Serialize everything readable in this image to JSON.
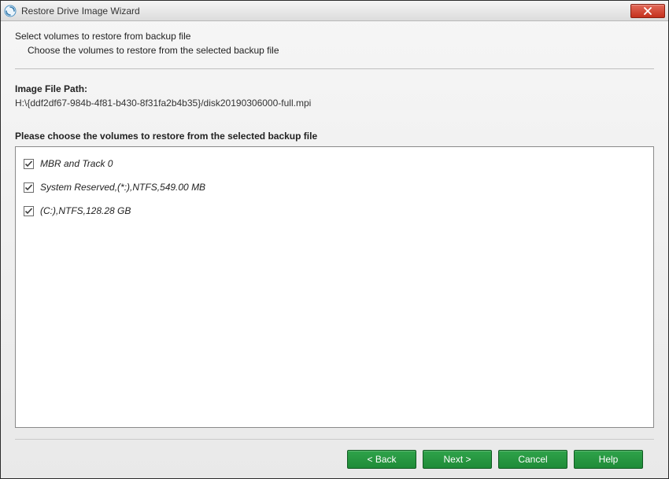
{
  "window": {
    "title": "Restore Drive Image Wizard"
  },
  "header": {
    "line1": "Select volumes to restore from backup file",
    "line2": "Choose the volumes to restore from the selected backup file"
  },
  "image_file": {
    "label": "Image File Path:",
    "path": "H:\\{ddf2df67-984b-4f81-b430-8f31fa2b4b35}/disk20190306000-full.mpi"
  },
  "choose_label": "Please choose the volumes to restore from the selected backup file",
  "volumes": [
    {
      "label": "MBR and Track 0",
      "checked": true
    },
    {
      "label": "System Reserved,(*:),NTFS,549.00 MB",
      "checked": true
    },
    {
      "label": "(C:),NTFS,128.28 GB",
      "checked": true
    }
  ],
  "buttons": {
    "back": "< Back",
    "next": "Next >",
    "cancel": "Cancel",
    "help": "Help"
  },
  "colors": {
    "button_green": "#1f8b38",
    "close_red": "#c4301c"
  }
}
